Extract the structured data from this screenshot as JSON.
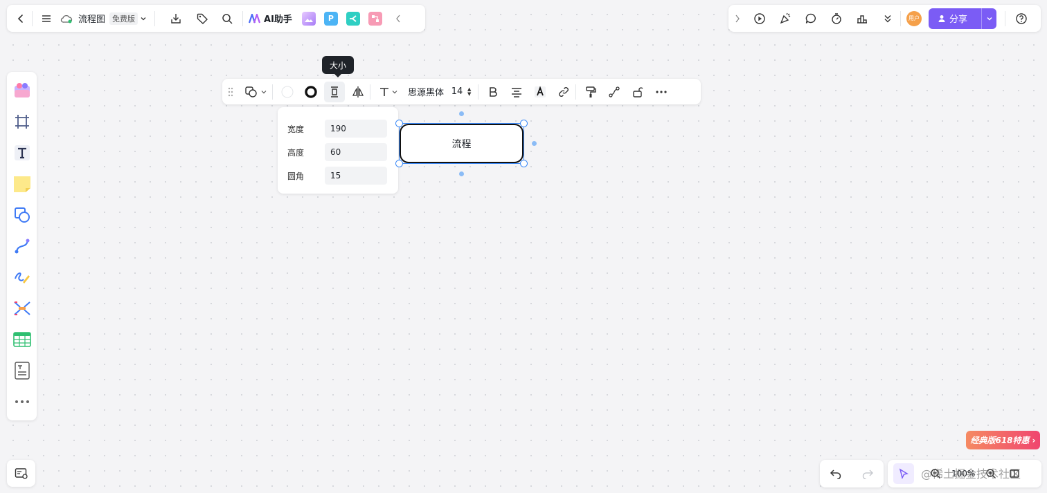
{
  "top_left": {
    "doc_title": "流程图",
    "plan_badge": "免费版",
    "ai_label": "AI助手"
  },
  "top_right": {
    "avatar_label": "用户",
    "share_label": "分享"
  },
  "tooltip": {
    "text": "大小"
  },
  "format_bar": {
    "font_name": "思源黑体",
    "font_size": "14"
  },
  "size_popover": {
    "width_label": "宽度",
    "width_value": "190",
    "height_label": "高度",
    "height_value": "60",
    "radius_label": "圆角",
    "radius_value": "15"
  },
  "canvas": {
    "shape_text": "流程"
  },
  "bottom": {
    "zoom": "100%",
    "promo": "经典版618特惠",
    "watermark": "@稀土掘金技术社区"
  },
  "colors": {
    "accent": "#7b5cf5",
    "selection": "#3d8af7",
    "promo_start": "#f58a62",
    "promo_end": "#f0456f"
  }
}
